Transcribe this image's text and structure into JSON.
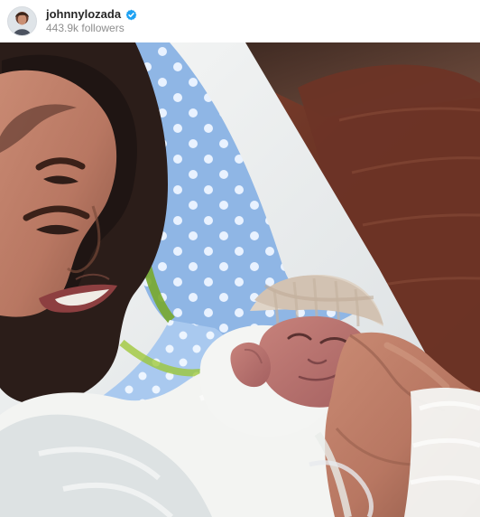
{
  "post": {
    "author": {
      "username": "johnnylozada",
      "followers": "443.9k followers",
      "verified": true
    },
    "icons": {
      "avatar": "profile-avatar",
      "verified": "verified-check-icon"
    },
    "colors": {
      "username": "#262626",
      "muted": "#8e8e8e",
      "verified": "#1DA1F2"
    }
  }
}
